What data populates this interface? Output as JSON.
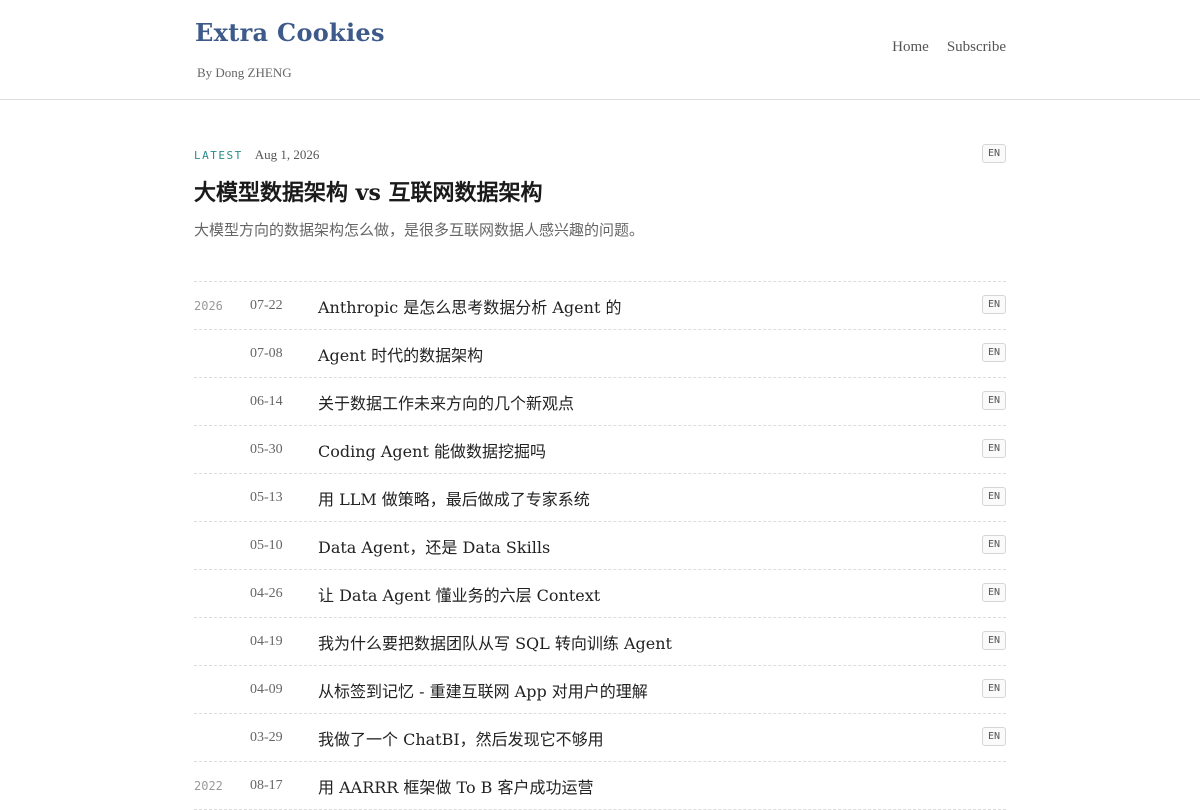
{
  "site": {
    "title": "Extra Cookies",
    "byline": "By Dong ZHENG",
    "nav": [
      {
        "label": "Home"
      },
      {
        "label": "Subscribe"
      }
    ]
  },
  "featured": {
    "tag": "LATEST",
    "date": "Aug 1, 2026",
    "lang": "EN",
    "title": "大模型数据架构 vs 互联网数据架构",
    "subtitle": "大模型方向的数据架构怎么做，是很多互联网数据人感兴趣的问题。"
  },
  "posts": [
    {
      "year": "2026",
      "date": "07-22",
      "title": "Anthropic 是怎么思考数据分析 Agent 的",
      "lang": "EN"
    },
    {
      "year": "",
      "date": "07-08",
      "title": "Agent 时代的数据架构",
      "lang": "EN"
    },
    {
      "year": "",
      "date": "06-14",
      "title": "关于数据工作未来方向的几个新观点",
      "lang": "EN"
    },
    {
      "year": "",
      "date": "05-30",
      "title": "Coding Agent 能做数据挖掘吗",
      "lang": "EN"
    },
    {
      "year": "",
      "date": "05-13",
      "title": "用 LLM 做策略，最后做成了专家系统",
      "lang": "EN"
    },
    {
      "year": "",
      "date": "05-10",
      "title": "Data Agent，还是 Data Skills",
      "lang": "EN"
    },
    {
      "year": "",
      "date": "04-26",
      "title": "让 Data Agent 懂业务的六层 Context",
      "lang": "EN"
    },
    {
      "year": "",
      "date": "04-19",
      "title": "我为什么要把数据团队从写 SQL 转向训练 Agent",
      "lang": "EN"
    },
    {
      "year": "",
      "date": "04-09",
      "title": "从标签到记忆 - 重建互联网 App 对用户的理解",
      "lang": "EN"
    },
    {
      "year": "",
      "date": "03-29",
      "title": "我做了一个 ChatBI，然后发现它不够用",
      "lang": "EN"
    },
    {
      "year": "2022",
      "date": "08-17",
      "title": "用 AARRR 框架做 To B 客户成功运营",
      "lang": ""
    }
  ]
}
